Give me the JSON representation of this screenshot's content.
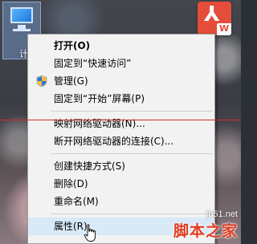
{
  "desktop": {
    "icons": [
      {
        "label": "计",
        "icon": "this-pc-icon"
      },
      {
        "label": "W",
        "icon": "pdf-app-icon"
      }
    ]
  },
  "context_menu": {
    "items": [
      {
        "label": "打开(O)",
        "bold": true,
        "icon": null
      },
      {
        "label": "固定到“快速访问”",
        "icon": null
      },
      {
        "label": "管理(G)",
        "icon": "uac-shield-icon"
      },
      {
        "label": "固定到“开始”屏幕(P)",
        "icon": null
      },
      {
        "label": "映射网络驱动器(N)...",
        "icon": null
      },
      {
        "label": "断开网络驱动器的连接(C)...",
        "icon": null
      },
      {
        "label": "创建快捷方式(S)",
        "icon": null
      },
      {
        "label": "删除(D)",
        "icon": null
      },
      {
        "label": "重命名(M)",
        "icon": null
      },
      {
        "label": "属性(R)",
        "icon": null,
        "highlighted": true
      }
    ]
  },
  "watermark": {
    "line1": "jb51.net",
    "line2": "脚本之家"
  },
  "colors": {
    "menu_bg": "#f2f2f2",
    "menu_highlight": "#d8e9f8",
    "annotation_line": "#d42a2a",
    "pdf_icon": "#e34d3a",
    "watermark_red": "#e23b1f"
  }
}
